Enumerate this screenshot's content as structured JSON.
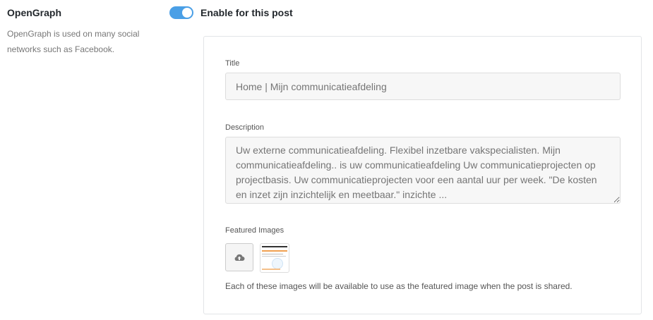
{
  "section": {
    "title": "OpenGraph",
    "description": "OpenGraph is used on many social networks such as Facebook."
  },
  "toggle": {
    "label": "Enable for this post",
    "enabled": true,
    "color": "#4a9fe6"
  },
  "fields": {
    "title": {
      "label": "Title",
      "placeholder": "Home | Mijn communicatieafdeling"
    },
    "description": {
      "label": "Description",
      "placeholder": "Uw externe communicatieafdeling. Flexibel inzetbare vakspecialisten. Mijn communicatieafdeling.. is uw communicatieafdeling Uw communicatieprojecten op projectbasis. Uw communicatieprojecten voor een aantal uur per week. \"De kosten en inzet zijn inzichtelijk en meetbaar.\" inzichte ..."
    }
  },
  "featured_images": {
    "label": "Featured Images",
    "upload_icon": "cloud-upload-icon",
    "help_text": "Each of these images will be available to use as the featured image when the post is shared."
  }
}
